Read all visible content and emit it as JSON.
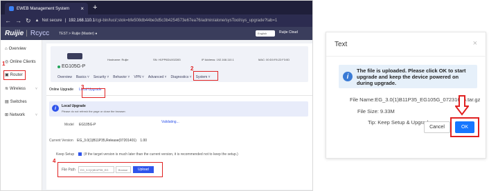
{
  "browser": {
    "tab_title": "EWEB Management System",
    "url_warning": "Not secure",
    "url_host": "192.168.110.1",
    "url_path": "/cgi-bin/luci/;stok=bfe508db44be3d5c3b4254573e67ea76/admin/alone/sysTool/sys_upgrade?tab=1"
  },
  "app": {
    "brand": "Ruijie",
    "brand2": "Rcycc",
    "project": "TEST > Ruijie (Master) ●",
    "language": "English",
    "cloud": "Ruijie Cloud"
  },
  "sidebar": {
    "items": [
      {
        "label": "Overview",
        "icon": "overview-icon"
      },
      {
        "label": "Online Clients",
        "icon": "clients-icon"
      },
      {
        "label": "Router",
        "icon": "router-icon"
      },
      {
        "label": "Wireless",
        "icon": "wireless-icon"
      },
      {
        "label": "Switches",
        "icon": "switches-icon"
      },
      {
        "label": "Network",
        "icon": "network-icon"
      }
    ]
  },
  "device": {
    "name": "EG105G-P",
    "hostname_label": "Hostname:",
    "hostname": "Ruijie",
    "sn_label": "SN:",
    "sn": "H1PP6DU002283",
    "ip_label": "IP Address:",
    "ip": "192.168.110.1",
    "mac_label": "MAC:",
    "mac": "00:D0:F8:22:F3:0D"
  },
  "nav": [
    "Overview",
    "Basics ˅",
    "Security ˅",
    "Behavior ˅",
    "VPN ˅",
    "Advanced ˅",
    "Diagnostics ˅",
    "System ˅"
  ],
  "upgrade_tabs": [
    "Online Upgrade",
    "Local Upgrade"
  ],
  "alert": {
    "title": "Local Upgrade",
    "body": "Please do not refresh the page or close the browser."
  },
  "form": {
    "model_label": "Model",
    "model_value": "EG105G-P",
    "current_version_label": "Current Version",
    "current_version_value": "EG_3.0(1)B11P35,Release(07201401)",
    "current_version_extra": "1.00",
    "validating": "Validating...",
    "keep_setup_label": "Keep Setup",
    "keep_setup_hint": "(If the target version is much later than the current version, it is recommended not to keep the setup.)",
    "file_path_label": "File Path",
    "file_path_value": "EG_3.0(1)B11P35_EG",
    "browse_label": "Browse",
    "upload_label": "Upload"
  },
  "steps": [
    "1",
    "2",
    "3",
    "4"
  ],
  "dialog": {
    "title": "Text",
    "close": "×",
    "message": "The file is uploaded. Please click OK to start upgrade and keep the device powered on during upgrade.",
    "file_name": "File Name:EG_3.0(1)B11P35_EG105G_07231606.tar.gz",
    "file_size": "File Size: 9.33M",
    "tip": "Tip: Keep Setup & Upgrade",
    "cancel": "Cancel",
    "ok": "OK"
  },
  "colors": {
    "accent": "#2f54eb",
    "highlight": "#e02020",
    "ok_button": "#1677ff"
  }
}
